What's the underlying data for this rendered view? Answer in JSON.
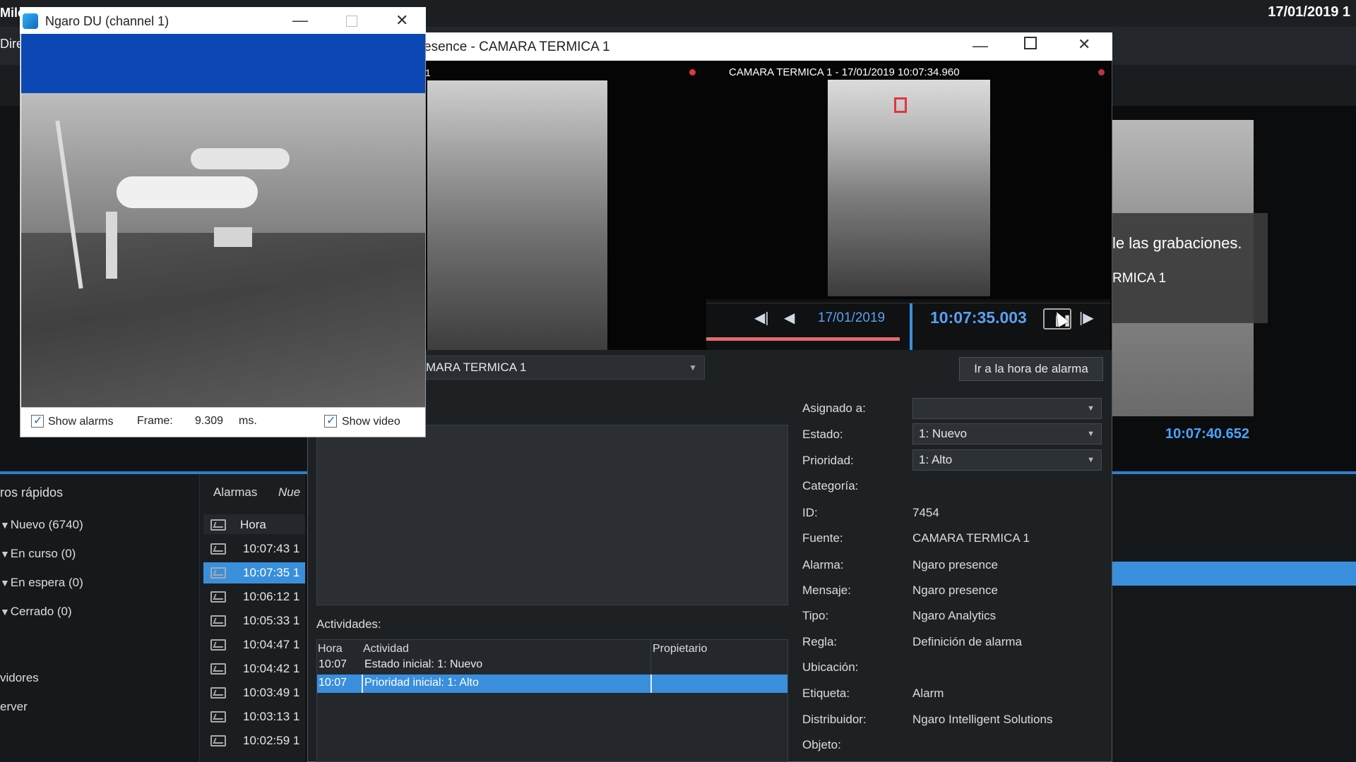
{
  "background_app": {
    "brand_fragment": "Mile",
    "date": "17/01/2019 1",
    "tab_fragment": "Dire",
    "tooltip_line1": "le las grabaciones.",
    "tooltip_line2": "RMICA 1",
    "right_time_fragment": "10:07:40.652"
  },
  "quick_filters": {
    "title": "ros rápidos",
    "items": [
      {
        "label": "Nuevo (6740)"
      },
      {
        "label": "En curso (0)"
      },
      {
        "label": "En espera (0)"
      },
      {
        "label": "Cerrado (0)"
      }
    ],
    "servers_label": "vidores",
    "server_label": "erver"
  },
  "alarm_list": {
    "tab_label": "Alarmas",
    "tab_new": "Nue",
    "column_header": "Hora",
    "rows": [
      {
        "time": "10:07:43 1"
      },
      {
        "time": "10:07:35 1"
      },
      {
        "time": "10:06:12 1"
      },
      {
        "time": "10:05:33 1"
      },
      {
        "time": "10:04:47 1"
      },
      {
        "time": "10:04:42 1"
      },
      {
        "time": "10:03:49 1"
      },
      {
        "time": "10:03:13 1"
      },
      {
        "time": "10:02:59 1"
      }
    ],
    "selected_index": 1
  },
  "alarm_window": {
    "title": "esence - CAMARA TERMICA 1",
    "left_video_label": "1",
    "right_video_label": "CAMARA TERMICA 1 - 17/01/2019 10:07:34.960",
    "player": {
      "date": "17/01/2019",
      "time": "10:07:35.003"
    },
    "source_select": "MARA TERMICA 1",
    "goto_button": "Ir a la hora de alarma",
    "activities_label": "Actividades:",
    "activities_table": {
      "headers": [
        "Hora",
        "Actividad",
        "Propietario"
      ],
      "rows": [
        {
          "time": "10:07",
          "activity": "Estado inicial: 1: Nuevo",
          "owner": ""
        },
        {
          "time": "10:07",
          "activity": "Prioridad inicial: 1: Alto",
          "owner": ""
        }
      ]
    },
    "properties": {
      "assigned_label": "Asignado a:",
      "assigned_value": "",
      "state_label": "Estado:",
      "state_value": "1: Nuevo",
      "priority_label": "Prioridad:",
      "priority_value": "1: Alto",
      "category_label": "Categoría:",
      "id_label": "ID:",
      "id_value": "7454",
      "source_label": "Fuente:",
      "source_value": "CAMARA TERMICA 1",
      "alarm_label": "Alarma:",
      "alarm_value": "Ngaro presence",
      "message_label": "Mensaje:",
      "message_value": "Ngaro presence",
      "type_label": "Tipo:",
      "type_value": "Ngaro Analytics",
      "rule_label": "Regla:",
      "rule_value": "Definición de alarma",
      "location_label": "Ubicación:",
      "tag_label": "Etiqueta:",
      "tag_value": "Alarm",
      "vendor_label": "Distribuidor:",
      "vendor_value": "Ngaro Intelligent Solutions",
      "object_label": "Objeto:"
    }
  },
  "popup": {
    "title": "Ngaro DU (channel 1)",
    "show_alarms_label": "Show alarms",
    "frame_label": "Frame:",
    "frame_value": "9.309",
    "frame_unit": "ms.",
    "show_video_label": "Show video"
  }
}
